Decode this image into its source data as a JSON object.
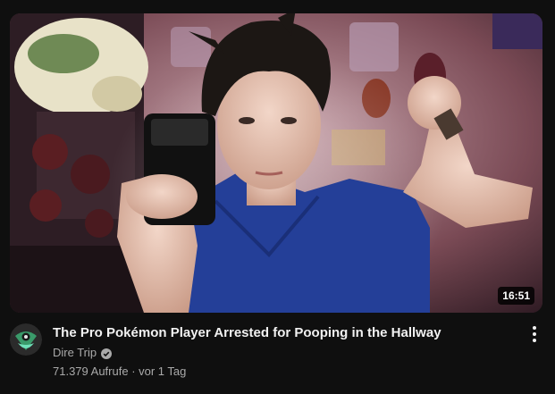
{
  "video": {
    "title": "The Pro Pokémon Player Arrested for Pooping in the Hallway",
    "duration": "16:51",
    "thumbnail_icon": "thumbnail-image"
  },
  "channel": {
    "name": "Dire Trip",
    "verified": true,
    "avatar_icon": "channel-avatar-icon"
  },
  "meta": {
    "views": "71.379 Aufrufe",
    "separator": " · ",
    "age": "vor 1 Tag"
  },
  "menu_icon": "more-vert-icon"
}
